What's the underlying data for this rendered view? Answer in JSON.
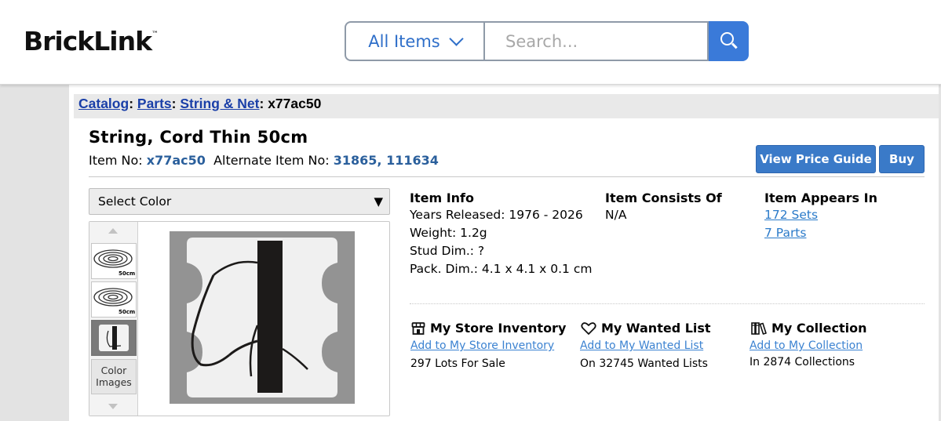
{
  "header": {
    "logo_text": "BrickLink",
    "logo_tm": "™",
    "category_label": "All Items",
    "search_placeholder": "Search..."
  },
  "breadcrumb": {
    "catalog": "Catalog",
    "parts": "Parts",
    "category": "String & Net",
    "current": "x77ac50"
  },
  "item": {
    "title": "String, Cord Thin 50cm",
    "item_no_label": "Item No:",
    "item_no": "x77ac50",
    "alt_label": "Alternate Item No:",
    "alt_no": "31865, 111634"
  },
  "buttons": {
    "price_guide": "View Price Guide",
    "buy": "Buy"
  },
  "color_select": {
    "label": "Select Color",
    "arrow": "▼"
  },
  "gallery": {
    "thumb_caption_1": "50cm",
    "thumb_caption_2": "50cm",
    "color_images_line1": "Color",
    "color_images_line2": "Images"
  },
  "item_info": {
    "heading": "Item Info",
    "years": "Years Released: 1976 - 2026",
    "weight": "Weight: 1.2g",
    "stud": "Stud Dim.: ?",
    "pack": "Pack. Dim.: 4.1 x 4.1 x 0.1 cm"
  },
  "consists_of": {
    "heading": "Item Consists Of",
    "value": "N/A"
  },
  "appears_in": {
    "heading": "Item Appears In",
    "sets": "172 Sets",
    "parts": "7 Parts"
  },
  "store": {
    "heading": "My Store Inventory",
    "link": "Add to My Store Inventory",
    "sub": "297 Lots For Sale"
  },
  "wanted": {
    "heading": "My Wanted List",
    "link": "Add to My Wanted List",
    "sub": "On 32745 Wanted Lists"
  },
  "collection": {
    "heading": "My Collection",
    "link": "Add to My Collection",
    "sub": "In 2874 Collections"
  }
}
